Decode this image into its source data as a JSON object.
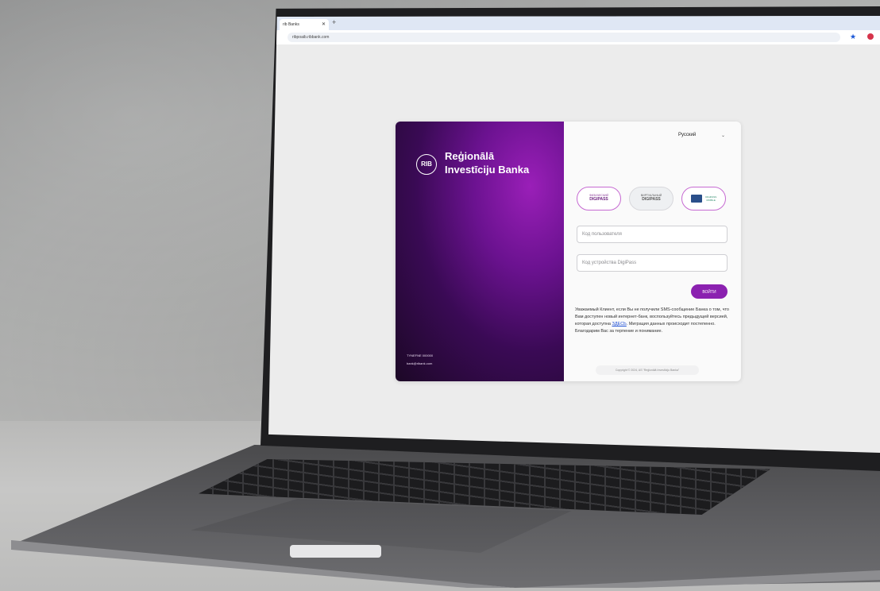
{
  "browser": {
    "tab_title": "rib Banks",
    "tab_close": "✕",
    "new_tab": "+",
    "url": "ribpoaib.ribbank.com"
  },
  "brand": {
    "logo": "RIB",
    "name_line1": "Reģionālā",
    "name_line2": "Investīciju Banka",
    "phone": "TYNEFNE 000000",
    "email": "bank@ribank.com"
  },
  "login": {
    "language": "Русский",
    "methods": [
      {
        "sub": "ФИЗИЧЕСКИЙ",
        "main": "DIGIPASS"
      },
      {
        "sub": "ВИРТУАЛЬНЫЙ",
        "main": "DIGIPASS"
      },
      {
        "sub": "DIGIPASS",
        "main": "MOBILE"
      }
    ],
    "user_code_placeholder": "Код пользователя",
    "device_code_placeholder": "Код устройства DigiPass",
    "login_button": "ВОЙТИ",
    "notice_part1": "Уважаемый Клиент, если Вы не получили SMS-сообщение Банка о том, что Вам доступен новый интернет-банк, воспользуйтесь предыдущей версией, которая доступна ",
    "notice_link": "ЗДЕСЬ",
    "notice_part2": ". Миграция данных происходит постепенно. Благодарим Вас за терпение и понимание.",
    "copyright": "Copyright © 2024, AS \"Reģionālā Investīciju Banka\""
  }
}
